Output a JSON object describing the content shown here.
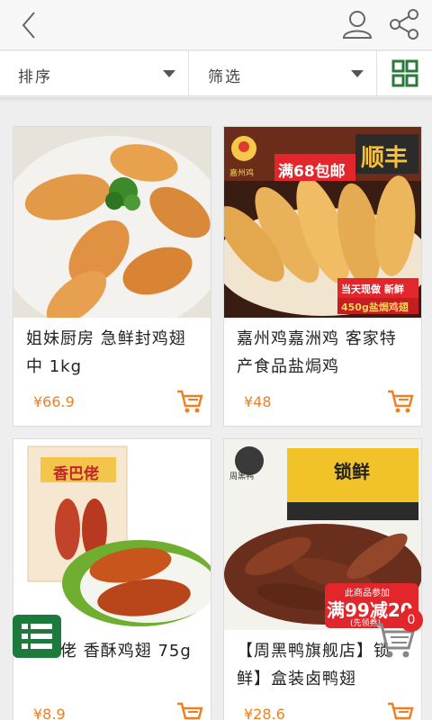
{
  "header": {
    "back_icon": "chevron-left-icon",
    "user_icon": "user-icon",
    "share_icon": "share-icon"
  },
  "filterbar": {
    "sort_label": "排序",
    "filter_label": "筛选",
    "grid_icon": "grid-view-icon",
    "accent_color": "#2a7a3a"
  },
  "products": [
    {
      "title": "姐妹厨房 急鲜封鸡翅中 1kg",
      "price": "¥66.9"
    },
    {
      "title": "嘉州鸡嘉洲鸡 客家特产食品盐焗鸡",
      "price": "¥48",
      "badges": {
        "promo": "满68包邮",
        "courier": "顺丰",
        "fresh": "当天现做 新鲜",
        "weight": "450g盐焗鸡翅",
        "brand": "嘉州鸡"
      }
    },
    {
      "title": "香巴佬 香酥鸡翅 75g",
      "price": "¥8.9",
      "badges": {
        "brand": "香巴佬"
      }
    },
    {
      "title": "【周黑鸭旗舰店】锁鲜】盒装卤鸭翅",
      "price": "¥28.6",
      "badges": {
        "brand": "周黑鸭",
        "box": "锁鲜",
        "promo": "满99减20",
        "promo_top": "此商品参加",
        "promo_sub": "(先领券)"
      }
    }
  ],
  "floating": {
    "list_icon": "list-icon",
    "cart_icon": "cart-icon",
    "cart_badge": "0"
  },
  "colors": {
    "price": "#f07f1f",
    "accent": "#2a7a3a",
    "badge": "#e3262b"
  }
}
